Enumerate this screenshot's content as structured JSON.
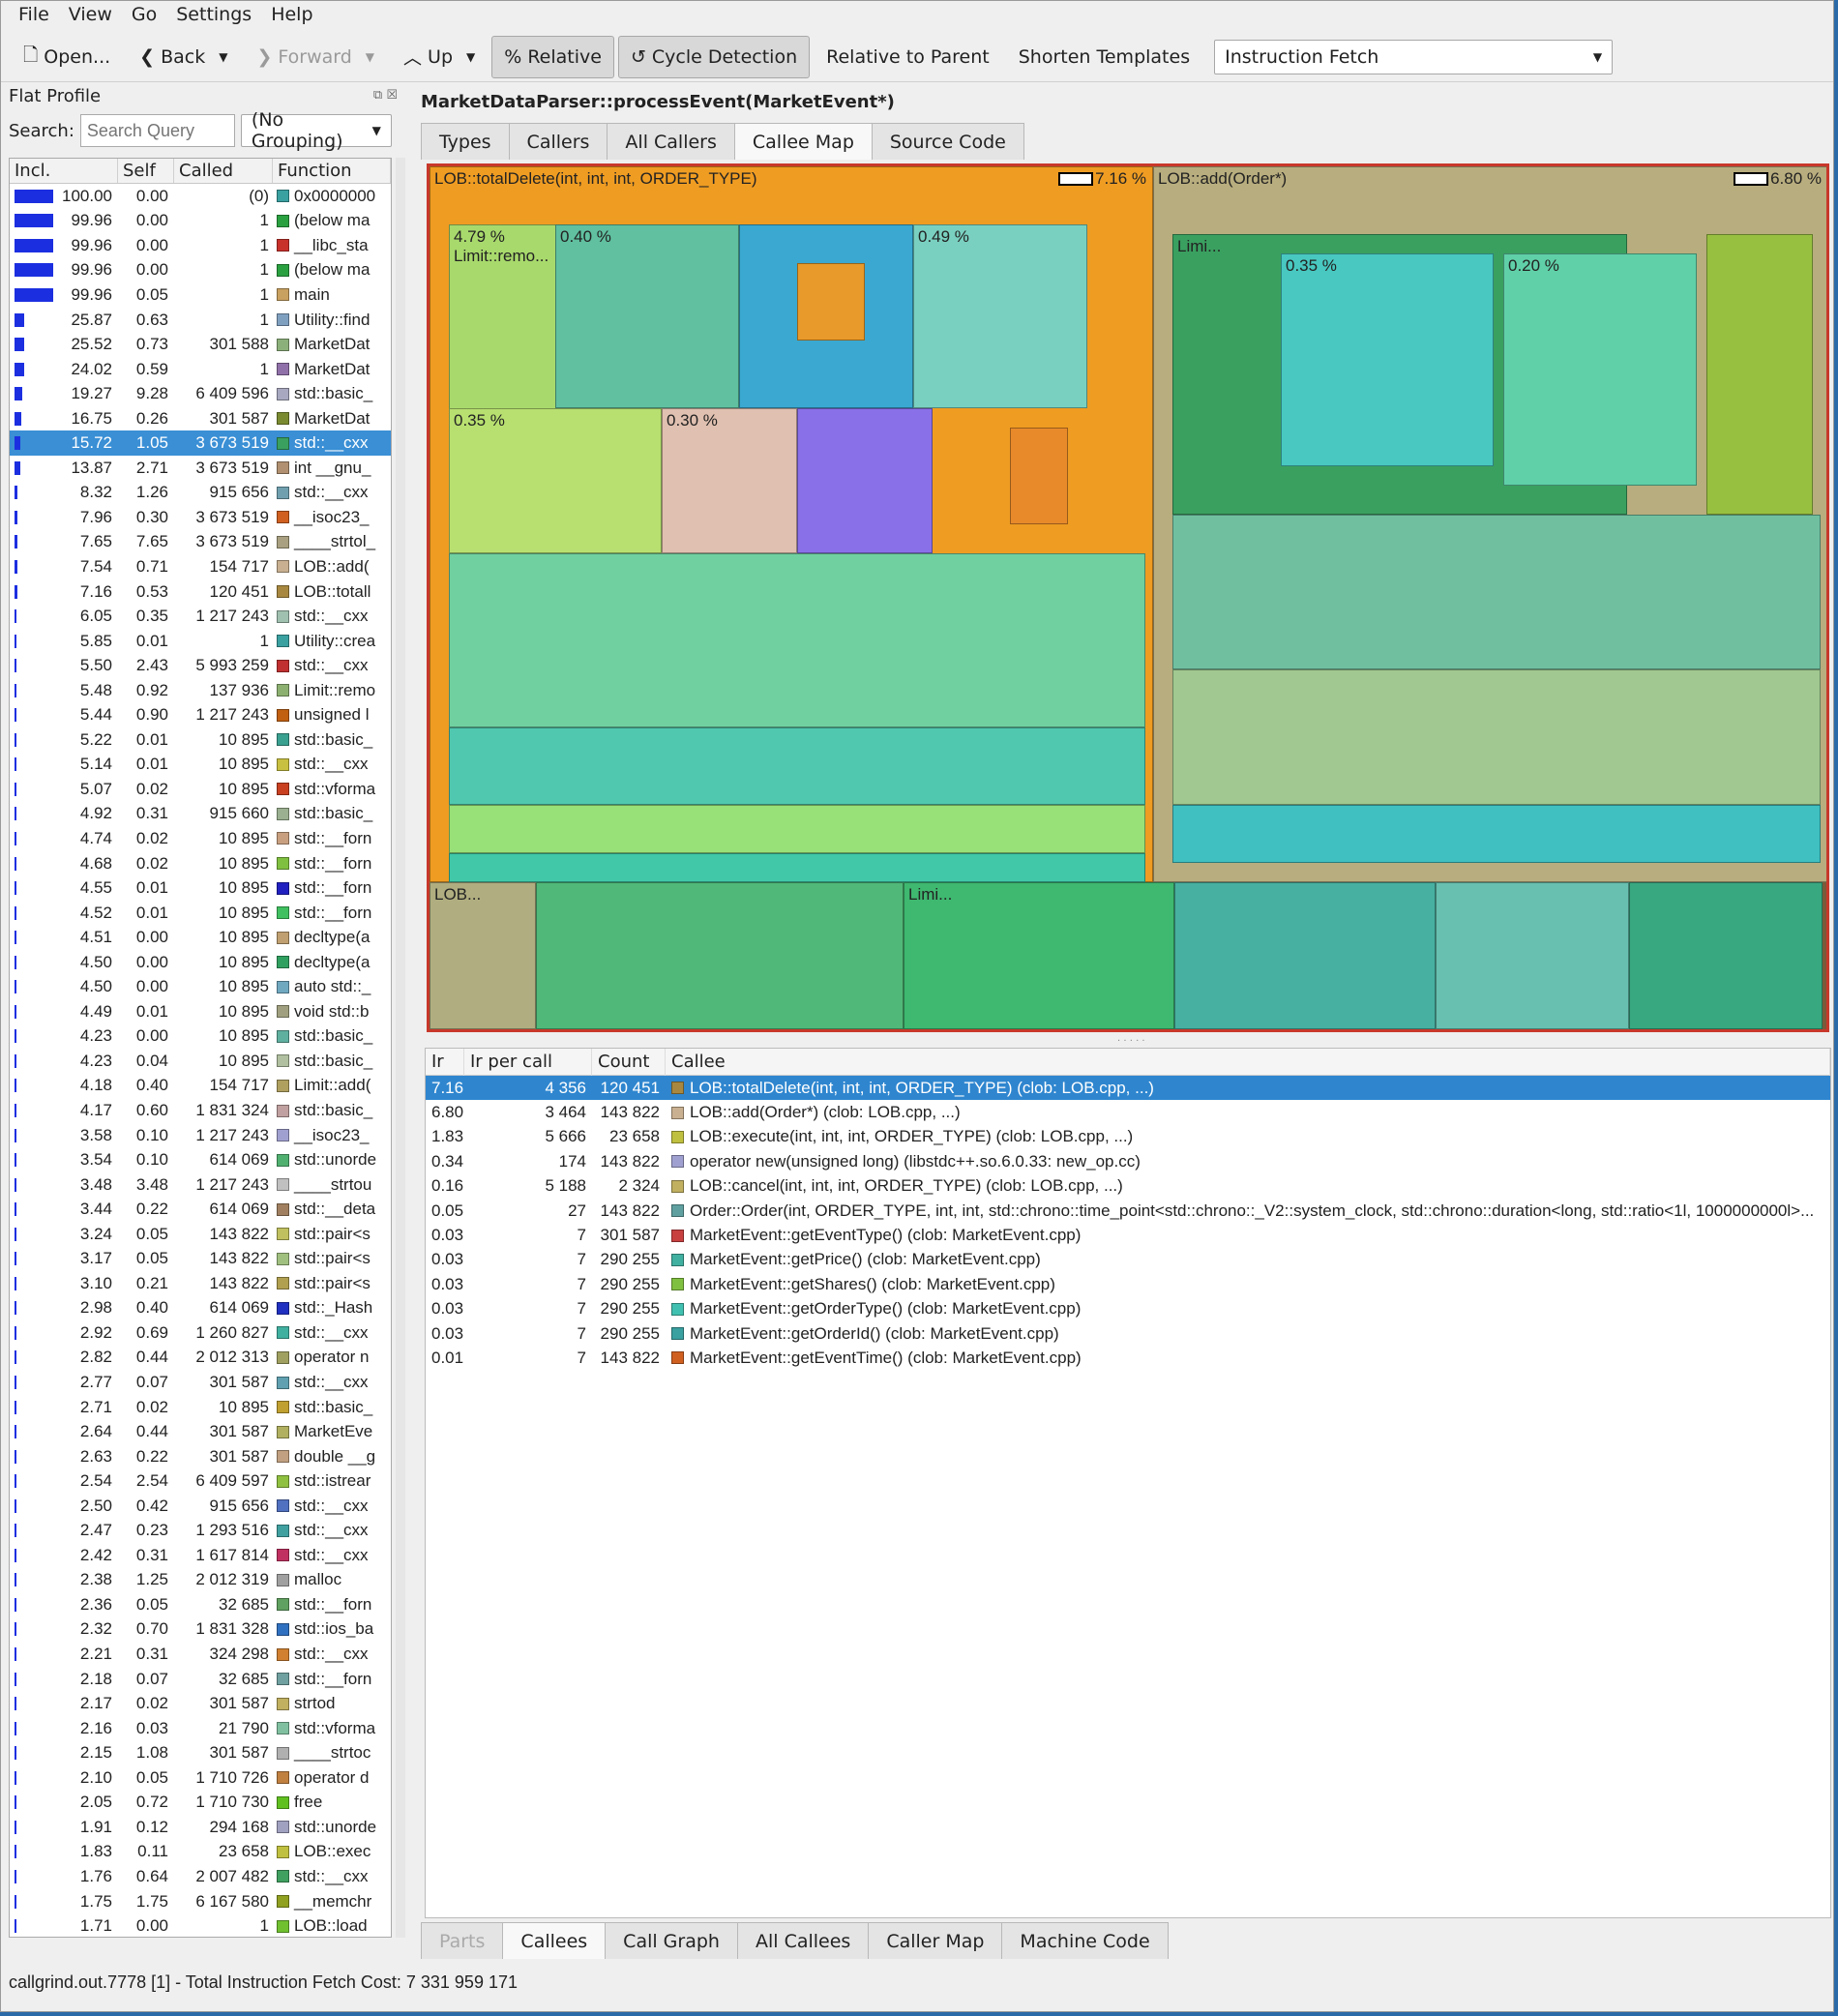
{
  "menu": [
    "File",
    "View",
    "Go",
    "Settings",
    "Help"
  ],
  "toolbar": {
    "open": "Open...",
    "back": "Back",
    "forward": "Forward",
    "up": "Up",
    "relative": "Relative",
    "cycle": "Cycle Detection",
    "relparent": "Relative to Parent",
    "shorten": "Shorten Templates",
    "event_type": "Instruction Fetch"
  },
  "flat_profile": {
    "title": "Flat Profile",
    "search_label": "Search:",
    "search_placeholder": "Search Query",
    "grouping": "(No Grouping)",
    "headers": [
      "Incl.",
      "Self",
      "Called",
      "Function"
    ],
    "rows": [
      [
        "100.00",
        "0.00",
        "(0)",
        "0x0000000",
        "#3aa0a0"
      ],
      [
        "99.96",
        "0.00",
        "1",
        "(below ma",
        "#2aa040"
      ],
      [
        "99.96",
        "0.00",
        "1",
        "__libc_sta",
        "#c8302a"
      ],
      [
        "99.96",
        "0.00",
        "1",
        "(below ma",
        "#2aa040"
      ],
      [
        "99.96",
        "0.05",
        "1",
        "main",
        "#c8a060"
      ],
      [
        "25.87",
        "0.63",
        "1",
        "Utility::find",
        "#80a0c0"
      ],
      [
        "25.52",
        "0.73",
        "301 588",
        "MarketDat",
        "#8cb07a"
      ],
      [
        "24.02",
        "0.59",
        "1",
        "MarketDat",
        "#9070a8"
      ],
      [
        "19.27",
        "9.28",
        "6 409 596",
        "std::basic_",
        "#a8a8c0"
      ],
      [
        "16.75",
        "0.26",
        "301 587",
        "MarketDat",
        "#7a8a30"
      ],
      [
        "15.72",
        "1.05",
        "3 673 519",
        "std::__cxx",
        "#3aa060"
      ],
      [
        "13.87",
        "2.71",
        "3 673 519",
        "int __gnu_",
        "#b09070"
      ],
      [
        "8.32",
        "1.26",
        "915 656",
        "std::__cxx",
        "#70a0b0"
      ],
      [
        "7.96",
        "0.30",
        "3 673 519",
        "__isoc23_",
        "#d06020"
      ],
      [
        "7.65",
        "7.65",
        "3 673 519",
        "____strtol_",
        "#a8a080"
      ],
      [
        "7.54",
        "0.71",
        "154 717",
        "LOB::add(",
        "#c8b090"
      ],
      [
        "7.16",
        "0.53",
        "120 451",
        "LOB::totall",
        "#a88840"
      ],
      [
        "6.05",
        "0.35",
        "1 217 243",
        "std::__cxx",
        "#a0c0b0"
      ],
      [
        "5.85",
        "0.01",
        "1",
        "Utility::crea",
        "#3aa0a0"
      ],
      [
        "5.50",
        "2.43",
        "5 993 259",
        "std::__cxx",
        "#c03030"
      ],
      [
        "5.48",
        "0.92",
        "137 936",
        "Limit::remo",
        "#8cb070"
      ],
      [
        "5.44",
        "0.90",
        "1 217 243",
        "unsigned l",
        "#c06010"
      ],
      [
        "5.22",
        "0.01",
        "10 895",
        "std::basic_",
        "#3aa090"
      ],
      [
        "5.14",
        "0.01",
        "10 895",
        "std::__cxx",
        "#c8c040"
      ],
      [
        "5.07",
        "0.02",
        "10 895",
        "std::vforma",
        "#c84020"
      ],
      [
        "4.92",
        "0.31",
        "915 660",
        "std::basic_",
        "#9ab090"
      ],
      [
        "4.74",
        "0.02",
        "10 895",
        "std::__forn",
        "#c8a080"
      ],
      [
        "4.68",
        "0.02",
        "10 895",
        "std::__forn",
        "#80c040"
      ],
      [
        "4.55",
        "0.01",
        "10 895",
        "std::__forn",
        "#2020c0"
      ],
      [
        "4.52",
        "0.01",
        "10 895",
        "std::__forn",
        "#40c060"
      ],
      [
        "4.51",
        "0.00",
        "10 895",
        "decltype(a",
        "#c0a070"
      ],
      [
        "4.50",
        "0.00",
        "10 895",
        "decltype(a",
        "#30a060"
      ],
      [
        "4.50",
        "0.00",
        "10 895",
        "auto std::_",
        "#70a8c0"
      ],
      [
        "4.49",
        "0.01",
        "10 895",
        "void std::b",
        "#a0a080"
      ],
      [
        "4.23",
        "0.00",
        "10 895",
        "std::basic_",
        "#60b0a0"
      ],
      [
        "4.23",
        "0.04",
        "10 895",
        "std::basic_",
        "#b0c0a0"
      ],
      [
        "4.18",
        "0.40",
        "154 717",
        "Limit::add(",
        "#b0a060"
      ],
      [
        "4.17",
        "0.60",
        "1 831 324",
        "std::basic_",
        "#c0a0a0"
      ],
      [
        "3.58",
        "0.10",
        "1 217 243",
        "__isoc23_",
        "#a0a0d0"
      ],
      [
        "3.54",
        "0.10",
        "614 069",
        "std::unorde",
        "#50b070"
      ],
      [
        "3.48",
        "3.48",
        "1 217 243",
        "____strtou",
        "#c0c0c0"
      ],
      [
        "3.44",
        "0.22",
        "614 069",
        "std::__deta",
        "#a08060"
      ],
      [
        "3.24",
        "0.05",
        "143 822",
        "std::pair<s",
        "#c0c060"
      ],
      [
        "3.17",
        "0.05",
        "143 822",
        "std::pair<s",
        "#a0c080"
      ],
      [
        "3.10",
        "0.21",
        "143 822",
        "std::pair<s",
        "#b0a050"
      ],
      [
        "2.98",
        "0.40",
        "614 069",
        "std::_Hash",
        "#2030c0"
      ],
      [
        "2.92",
        "0.69",
        "1 260 827",
        "std::__cxx",
        "#40b0a0"
      ],
      [
        "2.82",
        "0.44",
        "2 012 313",
        "operator n",
        "#a0a060"
      ],
      [
        "2.77",
        "0.07",
        "301 587",
        "std::__cxx",
        "#60a0b0"
      ],
      [
        "2.71",
        "0.02",
        "10 895",
        "std::basic_",
        "#c0a030"
      ],
      [
        "2.64",
        "0.44",
        "301 587",
        "MarketEve",
        "#b0b060"
      ],
      [
        "2.63",
        "0.22",
        "301 587",
        "double __g",
        "#c0a080"
      ],
      [
        "2.54",
        "2.54",
        "6 409 597",
        "std::istrear",
        "#90c040"
      ],
      [
        "2.50",
        "0.42",
        "915 656",
        "std::__cxx",
        "#5070c0"
      ],
      [
        "2.47",
        "0.23",
        "1 293 516",
        "std::__cxx",
        "#40a0a0"
      ],
      [
        "2.42",
        "0.31",
        "1 617 814",
        "std::__cxx",
        "#c03060"
      ],
      [
        "2.38",
        "1.25",
        "2 012 319",
        "malloc",
        "#a0a0a0"
      ],
      [
        "2.36",
        "0.05",
        "32 685",
        "std::__forn",
        "#60a060"
      ],
      [
        "2.32",
        "0.70",
        "1 831 328",
        "std::ios_ba",
        "#3070c0"
      ],
      [
        "2.21",
        "0.31",
        "324 298",
        "std::__cxx",
        "#d08030"
      ],
      [
        "2.18",
        "0.07",
        "32 685",
        "std::__forn",
        "#70a0a0"
      ],
      [
        "2.17",
        "0.02",
        "301 587",
        "strtod",
        "#c0b060"
      ],
      [
        "2.16",
        "0.03",
        "21 790",
        "std::vforma",
        "#80c0a0"
      ],
      [
        "2.15",
        "1.08",
        "301 587",
        "____strtoc",
        "#b0b0b0"
      ],
      [
        "2.10",
        "0.05",
        "1 710 726",
        "operator d",
        "#c08040"
      ],
      [
        "2.05",
        "0.72",
        "1 710 730",
        "free",
        "#60c020"
      ],
      [
        "1.91",
        "0.12",
        "294 168",
        "std::unorde",
        "#a0a0c0"
      ],
      [
        "1.83",
        "0.11",
        "23 658",
        "LOB::exec",
        "#c0c040"
      ],
      [
        "1.76",
        "0.64",
        "2 007 482",
        "std::__cxx",
        "#40a060"
      ],
      [
        "1.75",
        "1.75",
        "6 167 580",
        "__memchr",
        "#90a020"
      ],
      [
        "1.71",
        "0.00",
        "1",
        "LOB::load",
        "#70c030"
      ]
    ]
  },
  "right": {
    "function_name": "MarketDataParser::processEvent(MarketEvent*)",
    "top_tabs": [
      "Types",
      "Callers",
      "All Callers",
      "Callee Map",
      "Source Code"
    ],
    "bottom_tabs": [
      "Parts",
      "Callees",
      "Call Graph",
      "All Callees",
      "Caller Map",
      "Machine Code"
    ]
  },
  "treemap": {
    "total_delete": "LOB::totalDelete(int, int, int, ORDER_TYPE)",
    "total_delete_pct": "7.16 %",
    "add": "LOB::add(Order*)",
    "add_pct": "6.80 %",
    "limit_remove_pct": "4.79 %",
    "limit_remove": "Limit::remo...",
    "lob_execute": "LOB...",
    "limi": "Limi...",
    "p_unordered": "0.35 %",
    "p_boost": "0.49 %",
    "p_uns": "0.40 %",
    "p_b30": "0.30 %",
    "p_st35": "0.35 %",
    "p_20": "0.20 %"
  },
  "callees": {
    "headers": [
      "Ir",
      "Ir per call",
      "Count",
      "Callee"
    ],
    "rows": [
      [
        "7.16",
        "4 356",
        "120 451",
        "LOB::totalDelete(int, int, int, ORDER_TYPE) (clob: LOB.cpp, ...)",
        "#a88840"
      ],
      [
        "6.80",
        "3 464",
        "143 822",
        "LOB::add(Order*) (clob: LOB.cpp, ...)",
        "#c8b090"
      ],
      [
        "1.83",
        "5 666",
        "23 658",
        "LOB::execute(int, int, int, ORDER_TYPE) (clob: LOB.cpp, ...)",
        "#c0c040"
      ],
      [
        "0.34",
        "174",
        "143 822",
        "operator new(unsigned long) (libstdc++.so.6.0.33: new_op.cc)",
        "#a0a0d0"
      ],
      [
        "0.16",
        "5 188",
        "2 324",
        "LOB::cancel(int, int, int, ORDER_TYPE) (clob: LOB.cpp, ...)",
        "#c0b060"
      ],
      [
        "0.05",
        "27",
        "143 822",
        "Order::Order(int, ORDER_TYPE, int, int, std::chrono::time_point<std::chrono::_V2::system_clock, std::chrono::duration<long, std::ratio<1l, 1000000000l>...",
        "#60a0a0"
      ],
      [
        "0.03",
        "7",
        "301 587",
        "MarketEvent::getEventType() (clob: MarketEvent.cpp)",
        "#c84040"
      ],
      [
        "0.03",
        "7",
        "290 255",
        "MarketEvent::getPrice() (clob: MarketEvent.cpp)",
        "#40b0a0"
      ],
      [
        "0.03",
        "7",
        "290 255",
        "MarketEvent::getShares() (clob: MarketEvent.cpp)",
        "#80c040"
      ],
      [
        "0.03",
        "7",
        "290 255",
        "MarketEvent::getOrderType() (clob: MarketEvent.cpp)",
        "#40c0b0"
      ],
      [
        "0.03",
        "7",
        "290 255",
        "MarketEvent::getOrderId() (clob: MarketEvent.cpp)",
        "#3aa0a0"
      ],
      [
        "0.01",
        "7",
        "143 822",
        "MarketEvent::getEventTime() (clob: MarketEvent.cpp)",
        "#d06020"
      ]
    ]
  },
  "status": "callgrind.out.7778 [1] - Total Instruction Fetch Cost: 7 331 959 171"
}
